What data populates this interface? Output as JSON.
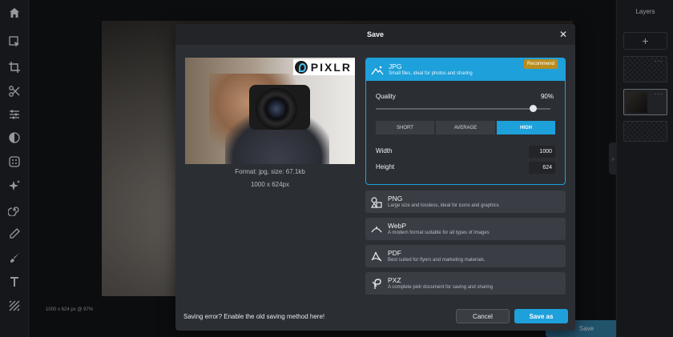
{
  "canvas": {
    "status": "1000 x 624 px @ 97%",
    "save_button": "Save"
  },
  "layers": {
    "title": "Layers",
    "add_label": "+",
    "more_label": "···"
  },
  "modal": {
    "title": "Save",
    "close_label": "✕",
    "preview": {
      "logo_text": "PIXLR",
      "format_info": "Format: jpg, size: 67.1kb",
      "dimensions": "1000 x 624px"
    },
    "formats": [
      {
        "name": "JPG",
        "desc": "Small files, ideal for photos and sharing",
        "badge": "Recommend",
        "selected": true,
        "icon": "mountain-icon"
      },
      {
        "name": "PNG",
        "desc": "Large size and lossless, ideal for icons and graphics",
        "icon": "shapes-icon"
      },
      {
        "name": "WebP",
        "desc": "A modern format suitable for all types of images",
        "icon": "arc-icon"
      },
      {
        "name": "PDF",
        "desc": "Best suited for flyers and marketing materials.",
        "icon": "pdf-icon"
      },
      {
        "name": "PXZ",
        "desc": "A complete pixlr document for saving and sharing",
        "icon": "pixlr-icon"
      }
    ],
    "jpg_settings": {
      "quality_label": "Quality",
      "quality_value": "90%",
      "quality_fraction": 0.9,
      "presets": [
        "SHORT",
        "AVERAGE",
        "HIGH"
      ],
      "active_preset": "HIGH",
      "width_label": "Width",
      "width_value": "1000",
      "height_label": "Height",
      "height_value": "624"
    },
    "footer": {
      "error_text": "Saving error? Enable the old saving method here!",
      "cancel_label": "Cancel",
      "save_as_label": "Save as"
    }
  },
  "colors": {
    "accent": "#1ea0da",
    "badge": "#b88d1e"
  }
}
